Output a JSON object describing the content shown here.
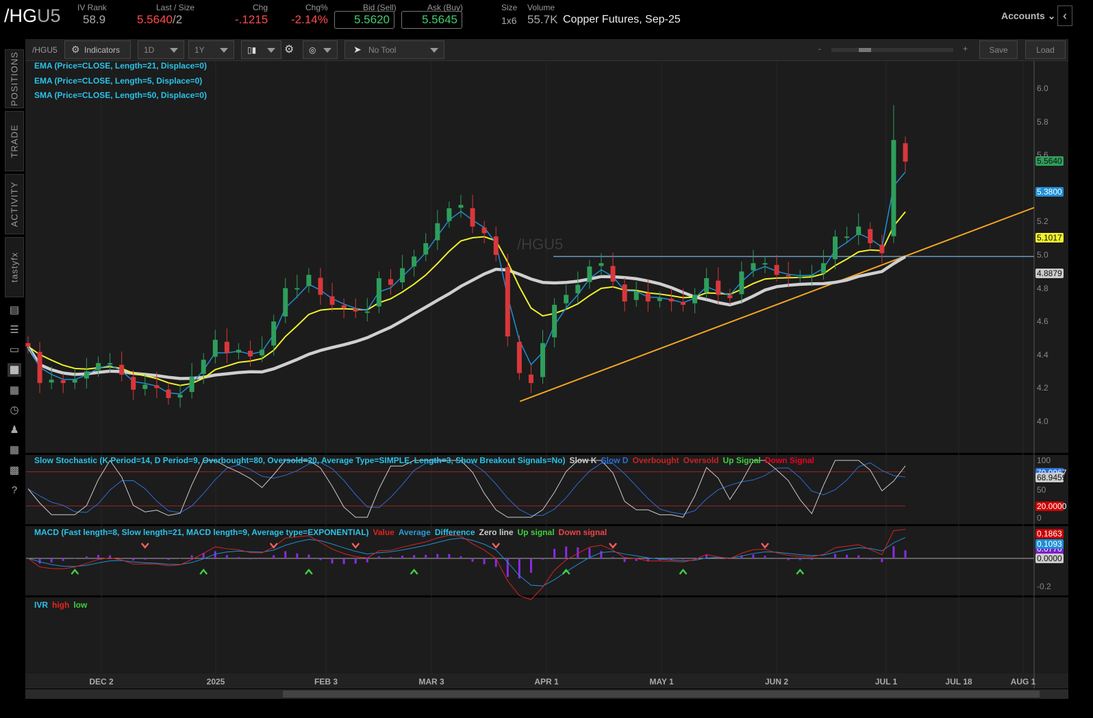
{
  "header": {
    "symbol_prefix": "/HG",
    "symbol_suffix": "U5",
    "iv_rank_label": "IV Rank",
    "iv_rank": "58.9",
    "last_label": "Last / Size",
    "last": "5.5640",
    "size": "/2",
    "chg_label": "Chg",
    "chg": "-.1215",
    "chgpct_label": "Chg%",
    "chgpct": "-2.14%",
    "bid_label": "Bid (Sell)",
    "bid": "5.5620",
    "ask_label": "Ask (Buy)",
    "ask": "5.5645",
    "size_label": "Size",
    "size_val": "1x6",
    "volume_label": "Volume",
    "volume": "55.7K",
    "description": "Copper Futures, Sep-25",
    "accounts": "Accounts"
  },
  "toolbar": {
    "symbol": "/HGU5",
    "indicators": "Indicators",
    "aggregation": "1D",
    "range": "1Y",
    "tool": "No Tool",
    "save": "Save",
    "load": "Load",
    "zoom_minus": "-",
    "zoom_plus": "+"
  },
  "sidebar": {
    "tabs": [
      "POSITIONS",
      "TRADE",
      "ACTIVITY",
      "tastyfx"
    ]
  },
  "studies": {
    "ema21": "EMA (Price=CLOSE, Length=21, Displace=0)",
    "ema5": "EMA (Price=CLOSE, Length=5, Displace=0)",
    "sma50": "SMA (Price=CLOSE, Length=50, Displace=0)",
    "watermark": "/HGU5"
  },
  "stoch": {
    "title": "Slow Stochastic (K Period=14, D Period=9, Overbought=80, Oversold=20, Average Type=SIMPLE, Length=3, Show Breakout Signals=No)",
    "slowk": "Slow K",
    "slowd": "Slow D",
    "ob": "Overbought",
    "os": "Oversold",
    "up": "Up Signal",
    "down": "Down Signal",
    "ticks": [
      "100",
      "50",
      "0"
    ],
    "tag_d": "70.0967",
    "tag_k": "68.9459",
    "tag_os": "20.0000"
  },
  "macd": {
    "title": "MACD (Fast length=8, Slow length=21, MACD length=9, Average type=EXPONENTIAL)",
    "value": "Value",
    "average": "Average",
    "difference": "Difference",
    "zero": "Zero line",
    "up": "Up signal",
    "down": "Down signal",
    "tick": "-0.2",
    "tag_value": "0.1863",
    "tag_avg": "0.1093",
    "tag_diff": "0.0770",
    "tag_zero": "0.0000"
  },
  "ivr": {
    "title": "IVR",
    "high": "high",
    "low": "low"
  },
  "price_tags": {
    "last": "5.5640",
    "ema5": "5.3800",
    "ema21": "5.1017",
    "sma50": "4.8879"
  },
  "colors": {
    "up": "#2e9e5b",
    "down": "#d9373a",
    "ema5": "#1e8fd6",
    "ema21": "#f2f22b",
    "sma50": "#cfcfcf",
    "trend": "#f5a623",
    "resistance": "#6a9cc0"
  },
  "chart_data": {
    "type": "candlestick",
    "title": "/HGU5 Copper Futures, Sep-25 — 1Y 1D",
    "yaxis_ticks": [
      "6.0",
      "5.8",
      "5.6",
      "5.2",
      "5.0",
      "4.8",
      "4.6",
      "4.4",
      "4.2",
      "4.0"
    ],
    "ylim": [
      3.9,
      6.1
    ],
    "x_ticks": [
      "DEC 2",
      "2025",
      "FEB 3",
      "MAR 3",
      "APR 1",
      "MAY 1",
      "JUN 2",
      "JUL 1",
      "JUL 18",
      "AUG 1"
    ],
    "closes": [
      4.45,
      4.23,
      4.25,
      4.23,
      4.25,
      4.3,
      4.35,
      4.35,
      4.28,
      4.19,
      4.22,
      4.2,
      4.14,
      4.16,
      4.27,
      4.37,
      4.49,
      4.41,
      4.43,
      4.39,
      4.43,
      4.6,
      4.8,
      4.8,
      4.88,
      4.76,
      4.7,
      4.68,
      4.66,
      4.66,
      4.86,
      4.82,
      4.92,
      4.99,
      5.07,
      5.19,
      5.28,
      5.3,
      5.17,
      5.13,
      5.0,
      4.51,
      4.29,
      4.23,
      4.47,
      4.7,
      4.76,
      4.82,
      4.93,
      4.95,
      4.84,
      4.72,
      4.78,
      4.72,
      4.74,
      4.72,
      4.7,
      4.76,
      4.86,
      4.76,
      4.74,
      4.9,
      4.95,
      4.95,
      4.88,
      4.87,
      4.87,
      4.88,
      4.95,
      5.11,
      5.11,
      5.17,
      5.07,
      5.01,
      5.69,
      5.56
    ],
    "resistance_level": 4.99,
    "trendline": {
      "from": [
        41,
        4.12
      ],
      "to": [
        84,
        5.28
      ]
    },
    "macd_up_signals": [
      4,
      15,
      24,
      33,
      46,
      56,
      66
    ],
    "macd_down_signals": [
      10,
      21,
      28,
      40,
      50,
      63
    ]
  }
}
